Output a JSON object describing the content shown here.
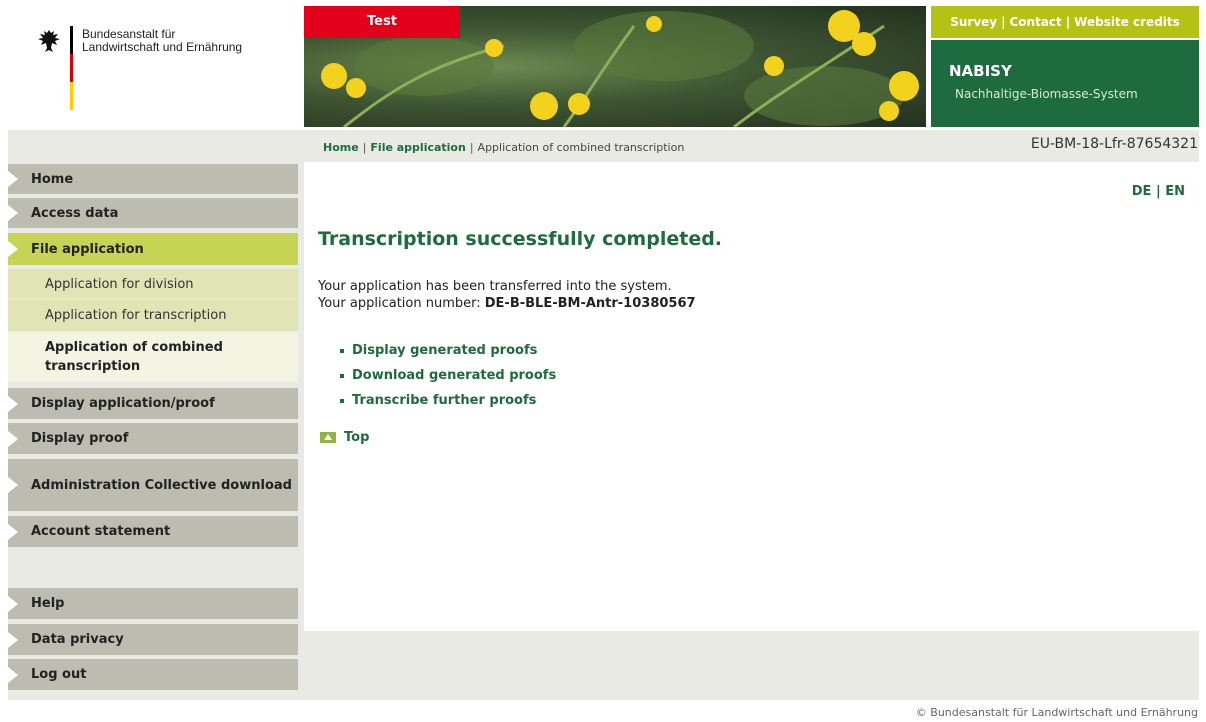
{
  "header": {
    "agency_line1": "Bundesanstalt für",
    "agency_line2": "Landwirtschaft und Ernährung",
    "test_badge": "Test",
    "top_links": {
      "survey": "Survey",
      "contact": "Contact",
      "credits": "Website credits"
    },
    "app_title": "NABISY",
    "app_subtitle": "Nachhaltige-Biomasse-System"
  },
  "breadcrumb": {
    "home": "Home",
    "section": "File application",
    "current": "Application of combined transcription",
    "separator": "|"
  },
  "user_id": "EU-BM-18-Lfr-87654321",
  "sidebar": {
    "items": [
      {
        "label": "Home"
      },
      {
        "label": "Access data"
      },
      {
        "label": "File application"
      },
      {
        "label": "Application for division"
      },
      {
        "label": "Application for transcription"
      },
      {
        "label": "Application of combined transcription"
      },
      {
        "label": "Display application/proof"
      },
      {
        "label": "Display proof"
      },
      {
        "label": "Administration Collective download"
      },
      {
        "label": "Account statement"
      },
      {
        "label": "Help"
      },
      {
        "label": "Data privacy"
      },
      {
        "label": "Log out"
      }
    ]
  },
  "main": {
    "lang_de": "DE",
    "lang_en": "EN",
    "lang_sep": "|",
    "heading": "Transcription successfully completed.",
    "message_line1": "Your application has been transferred into the system.",
    "message_line2_prefix": "Your application number:",
    "application_number": "DE-B-BLE-BM-Antr-10380567",
    "links": [
      {
        "label": "Display generated proofs"
      },
      {
        "label": "Download generated proofs"
      },
      {
        "label": "Transcribe further proofs"
      }
    ],
    "top_label": "Top"
  },
  "footer": "© Bundesanstalt für Landwirtschaft und Ernährung",
  "colors": {
    "brand_green": "#1d6b3e",
    "lime": "#b3c215",
    "test_red": "#e2001a",
    "nav_grey": "#bcbcb0",
    "nav_active": "#c6d354"
  }
}
